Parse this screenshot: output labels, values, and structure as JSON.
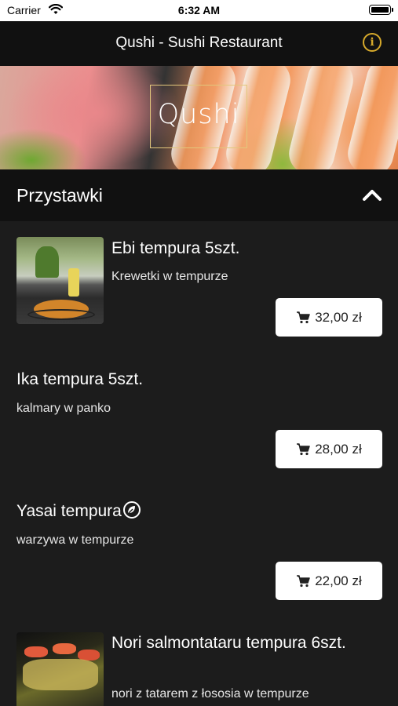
{
  "status_bar": {
    "carrier": "Carrier",
    "time": "6:32 AM"
  },
  "nav": {
    "title": "Qushi - Sushi Restaurant",
    "info_icon": "info-icon"
  },
  "hero": {
    "logo": "Qushi"
  },
  "section": {
    "title": "Przystawki",
    "toggle_icon": "chevron-up-icon"
  },
  "items": [
    {
      "name": "Ebi tempura 5szt.",
      "description": "Krewetki w tempurze",
      "price": "32,00 zł",
      "has_image": true
    },
    {
      "name": "Ika tempura 5szt.",
      "description": "kalmary w panko",
      "price": "28,00 zł",
      "has_image": false
    },
    {
      "name": "Yasai tempura",
      "description": "warzywa w tempurze",
      "price": "22,00 zł",
      "has_image": false,
      "badge_icon": "vegetarian-leaf-icon"
    },
    {
      "name": "Nori salmontataru tempura 6szt.",
      "description": "nori z tatarem z łososia w tempurze",
      "has_image": true
    }
  ],
  "colors": {
    "background": "#1c1c1c",
    "bar": "#111111",
    "accent": "#d6a92b",
    "button": "#ffffff"
  }
}
